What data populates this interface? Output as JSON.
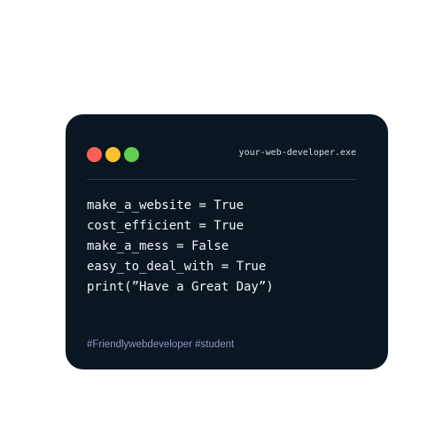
{
  "window": {
    "title": "your-web-developer.exe",
    "background_color": "#0a1622",
    "controls": [
      {
        "name": "close",
        "color": "#ff5f57"
      },
      {
        "name": "minimize",
        "color": "#fec02f"
      },
      {
        "name": "maximize",
        "color": "#5fcf4d"
      }
    ]
  },
  "code": {
    "lines": [
      "make_a_website = True",
      "cost_efficient = True",
      "make_a_mess = False",
      "easy_to_deal_with = True",
      "print(”Have a Great Day”)"
    ]
  },
  "footer": {
    "hashtags": "#Friendlywebdeveloper #student",
    "color": "#8a97c8"
  }
}
